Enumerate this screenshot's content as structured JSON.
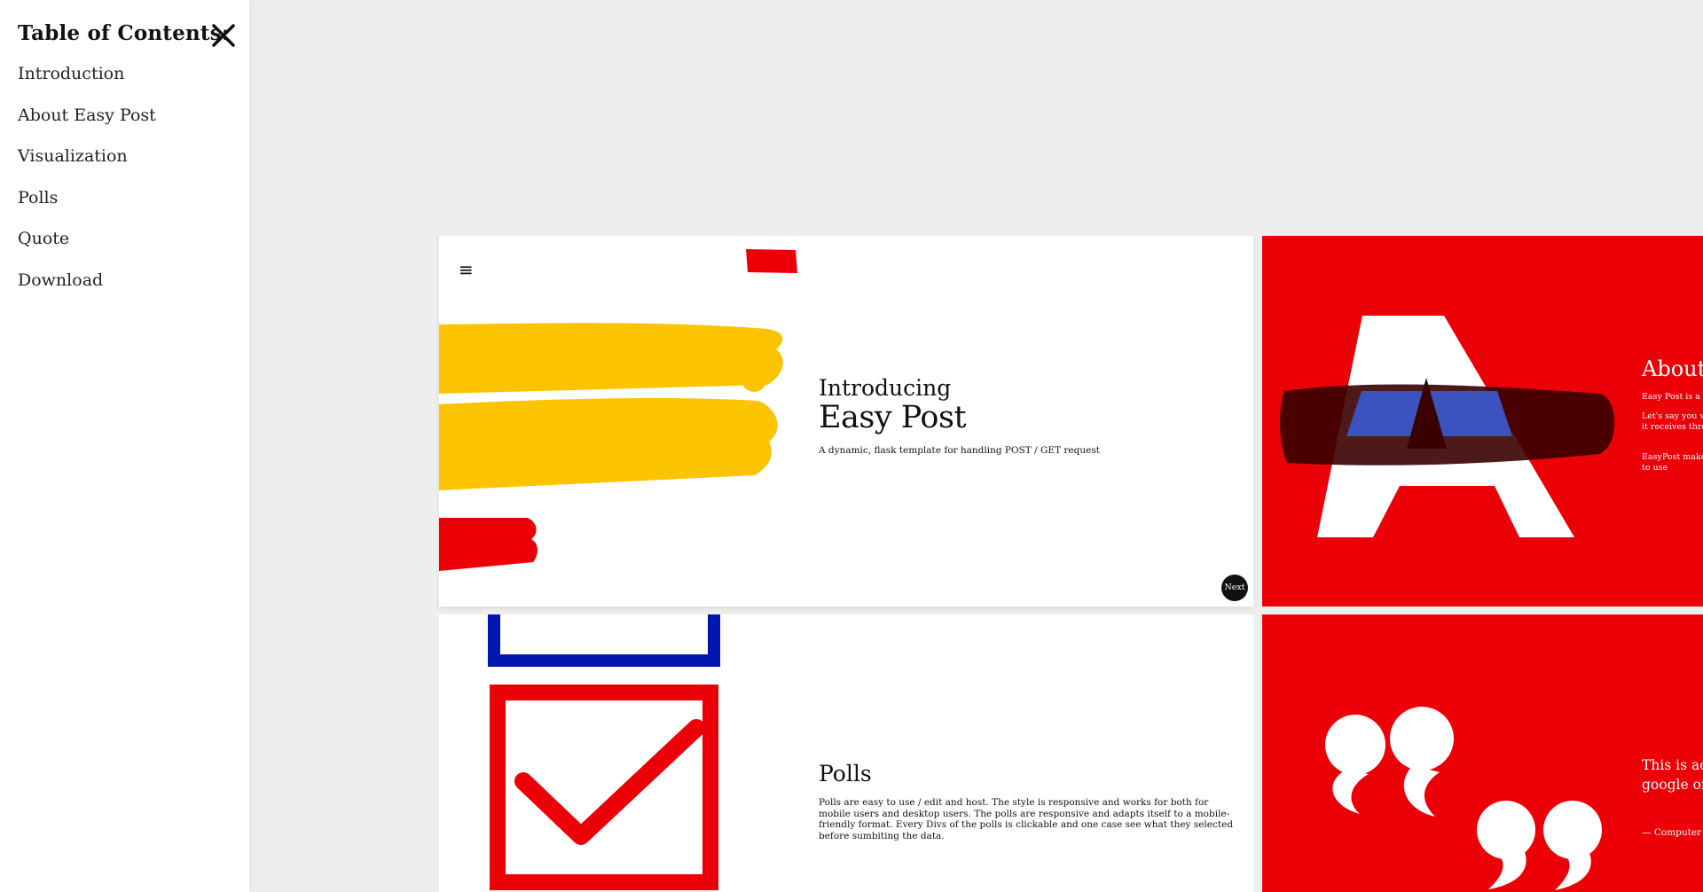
{
  "sidebar": {
    "title": "Table of Contents:",
    "close_icon": "close-icon",
    "items": [
      {
        "label": "Introduction"
      },
      {
        "label": "About Easy Post"
      },
      {
        "label": "Visualization"
      },
      {
        "label": "Polls"
      },
      {
        "label": "Quote"
      },
      {
        "label": "Download"
      }
    ]
  },
  "slides": {
    "intro": {
      "menu_icon": "hamburger-menu-icon",
      "menu_glyph": "≡",
      "line1": "Introducing",
      "title": "Easy Post",
      "description": "A dynamic, flask template for handling POST / GET request",
      "next_label": "Next"
    },
    "about": {
      "title": "About Easy Post",
      "paragraphs": [
        "Easy Post is a dynamic Flask template",
        "Let's say you want to host a poll and be able to store the data it receives through (form / polls) in your database",
        "EasyPost makes this possible; it is lightweight fast, and easy to use"
      ]
    },
    "polls": {
      "title": "Polls",
      "description": "Polls are easy to use / edit and host. The style is responsive and works for both for mobile users and desktop users. The polls are responsive and adapts itself to a mobile-friendly format. Every Divs of the polls is clickable and one case see what they selected before sumbiting the data."
    },
    "quote": {
      "text": "This is accessible through phones and google on every device.",
      "author": "— Computer Science"
    }
  },
  "colors": {
    "page_bg": "#eeeeee",
    "accent_red": "#ea0006",
    "yellow": "#fcc400",
    "blue": "#0016b0",
    "dark": "#111111"
  }
}
